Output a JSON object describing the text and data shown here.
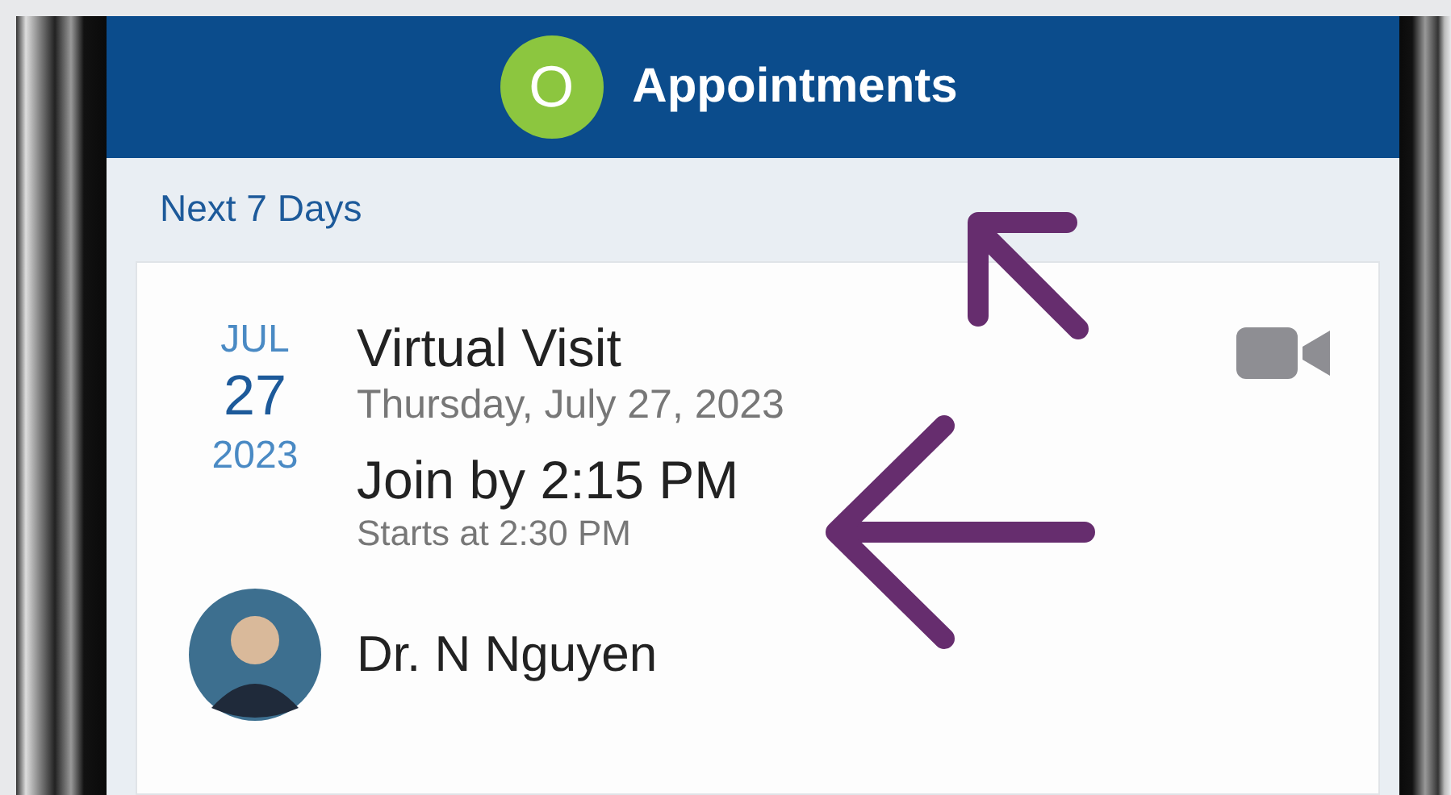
{
  "header": {
    "logo_letter": "O",
    "title": "Appointments"
  },
  "section_title": "Next 7 Days",
  "appointments": [
    {
      "kind": "video",
      "month": "JUL",
      "day": "27",
      "year": "2023",
      "title": "Virtual Visit",
      "date": "Thursday, July 27, 2023",
      "join_time": "Join by 2:15 PM",
      "start_time": "Starts at 2:30 PM",
      "provider": "Dr. N Nguyen"
    }
  ]
}
